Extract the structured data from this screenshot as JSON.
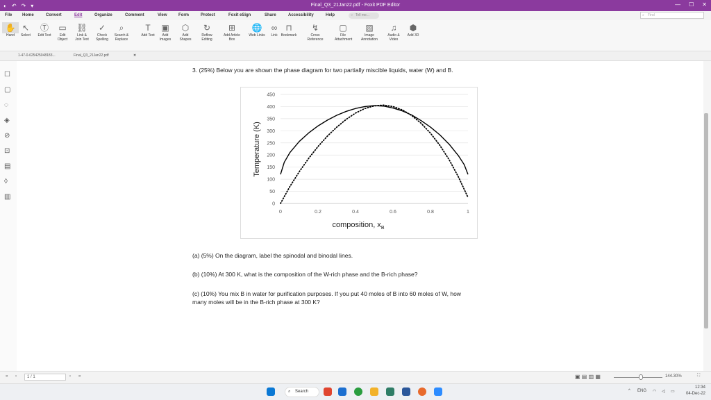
{
  "window": {
    "title": "Final_Q3_21Jan22.pdf - Foxit PDF Editor",
    "quick_access": [
      "↶",
      "↷",
      "▾"
    ],
    "controls": [
      "—",
      "☐",
      "✕"
    ]
  },
  "menu": {
    "items": [
      "File",
      "Home",
      "Convert",
      "Edit",
      "Organize",
      "Comment",
      "View",
      "Form",
      "Protect",
      "Foxit eSign",
      "Share",
      "Accessibility",
      "Help"
    ],
    "active": "Edit",
    "tell_me": "Tell me...",
    "find": "Find"
  },
  "ribbon": {
    "tools": [
      {
        "label": "Hand",
        "icon": "hand-icon"
      },
      {
        "label": "Select",
        "icon": "select-icon"
      },
      {
        "label": "Edit Text",
        "icon": "edit-text-icon"
      },
      {
        "label": "Edit Object",
        "icon": "edit-object-icon"
      },
      {
        "label": "Link & Join Text",
        "icon": "link-join-icon"
      },
      {
        "label": "Check Spelling",
        "icon": "spell-icon"
      },
      {
        "label": "Search & Replace",
        "icon": "search-replace-icon"
      },
      {
        "label": "Add Text",
        "icon": "add-text-icon"
      },
      {
        "label": "Add Images",
        "icon": "add-image-icon"
      },
      {
        "label": "Add Shapes",
        "icon": "add-shape-icon"
      },
      {
        "label": "Reflow Editing",
        "icon": "reflow-icon"
      },
      {
        "label": "Add Article Box",
        "icon": "article-icon"
      },
      {
        "label": "Web Links",
        "icon": "web-link-icon"
      },
      {
        "label": "Link",
        "icon": "link-icon"
      },
      {
        "label": "Bookmark",
        "icon": "bookmark-icon"
      },
      {
        "label": "Cross Reference",
        "icon": "cross-ref-icon"
      },
      {
        "label": "File Attachment",
        "icon": "attach-icon"
      },
      {
        "label": "Image Annotation",
        "icon": "image-annot-icon"
      },
      {
        "label": "Audio & Video",
        "icon": "audio-video-icon"
      },
      {
        "label": "Add 3D",
        "icon": "3d-icon"
      }
    ]
  },
  "tabs": {
    "left": "1-47-0-625425048183...",
    "doc": "Final_Q3_21Jan22.pdf"
  },
  "document": {
    "question": "3. (25%) Below you are shown the phase diagram for two partially miscible liquids, water (W) and B.",
    "qa": "(a) (5%) On the diagram, label the spinodal and binodal lines.",
    "qb": "(b) (10%) At 300 K, what is the composition of the W-rich phase and the B-rich phase?",
    "qc1": "(c) (10%) You mix B in water for purification purposes. If you put 40 moles of B into 60 moles of W, how",
    "qc2": "many moles will be in the B-rich phase at 300 K?"
  },
  "chart_data": {
    "type": "line",
    "xlabel_main": "composition, x",
    "xlabel_sub": "B",
    "ylabel": "Temperature (K)",
    "xlim": [
      0,
      1
    ],
    "ylim": [
      0,
      450
    ],
    "xticks": [
      "0",
      "0.2",
      "0.4",
      "0.6",
      "0.8",
      "1"
    ],
    "yticks": [
      "0",
      "50",
      "100",
      "150",
      "200",
      "250",
      "300",
      "350",
      "400",
      "450"
    ],
    "ytick_values": [
      0,
      50,
      100,
      150,
      200,
      250,
      300,
      350,
      400,
      450
    ],
    "xtick_values": [
      0,
      0.2,
      0.4,
      0.6,
      0.8,
      1
    ],
    "grid": true,
    "series": [
      {
        "style": "solid",
        "x": [
          0,
          0.02,
          0.05,
          0.1,
          0.15,
          0.2,
          0.25,
          0.3,
          0.35,
          0.4,
          0.45,
          0.5,
          0.55,
          0.6,
          0.65,
          0.7,
          0.75,
          0.8,
          0.85,
          0.9,
          0.95,
          0.98,
          1
        ],
        "y": [
          120,
          170,
          210,
          256,
          291,
          320,
          344,
          364,
          380,
          392,
          400,
          404,
          402,
          394,
          382,
          365,
          342,
          315,
          283,
          244,
          196,
          160,
          120
        ]
      },
      {
        "style": "dotted",
        "x": [
          0,
          0.05,
          0.1,
          0.15,
          0.2,
          0.25,
          0.3,
          0.35,
          0.4,
          0.45,
          0.5,
          0.55,
          0.6,
          0.65,
          0.7,
          0.75,
          0.8,
          0.85,
          0.9,
          0.95,
          1
        ],
        "y": [
          0,
          70,
          131,
          186,
          235,
          278,
          315,
          347,
          373,
          392,
          403,
          406,
          400,
          386,
          363,
          331,
          290,
          240,
          180,
          108,
          25
        ]
      }
    ]
  },
  "status": {
    "page": "1 / 1",
    "zoom": "144.30%"
  },
  "taskbar": {
    "search": "Search",
    "lang": "ENG",
    "time": "12:34",
    "date": "04-Dec-22"
  }
}
